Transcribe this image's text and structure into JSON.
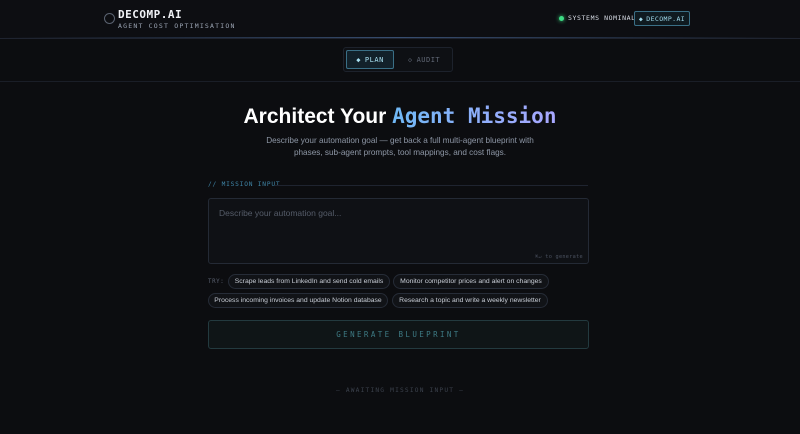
{
  "header": {
    "brand_title": "DECOMP.AI",
    "brand_subtitle": "AGENT COST OPTIMISATION",
    "status_text": "SYSTEMS NOMINAL",
    "status_color": "#3ddc84",
    "header_button_icon": "◆",
    "header_button_label": "DECOMP.AI"
  },
  "modes": {
    "plan_icon": "◆",
    "plan_label": "PLAN",
    "audit_icon": "◇",
    "audit_label": "AUDIT",
    "active": "PLAN"
  },
  "hero": {
    "title_main": "Architect Your ",
    "title_accent": "Agent Mission",
    "description": "Describe your automation goal — get back a full multi-agent blueprint with phases, sub-agent prompts, tool mappings, and cost flags."
  },
  "mission": {
    "section_label": "// MISSION INPUT",
    "placeholder": "Describe your automation goal...",
    "value": "",
    "shortcut_hint": "⌘↵ to generate"
  },
  "suggestions": {
    "label": "TRY:",
    "items": [
      "Scrape leads from LinkedIn and send cold emails",
      "Monitor competitor prices and alert on changes",
      "Process incoming invoices and update Notion database",
      "Research a topic and write a weekly newsletter"
    ]
  },
  "generate": {
    "label": "GENERATE BLUEPRINT"
  },
  "status": {
    "awaiting": "— AWAITING MISSION INPUT —"
  },
  "colors": {
    "accent": "#6fb8f5",
    "accent_secondary": "#a9a7ff",
    "background": "#0c0d10"
  }
}
